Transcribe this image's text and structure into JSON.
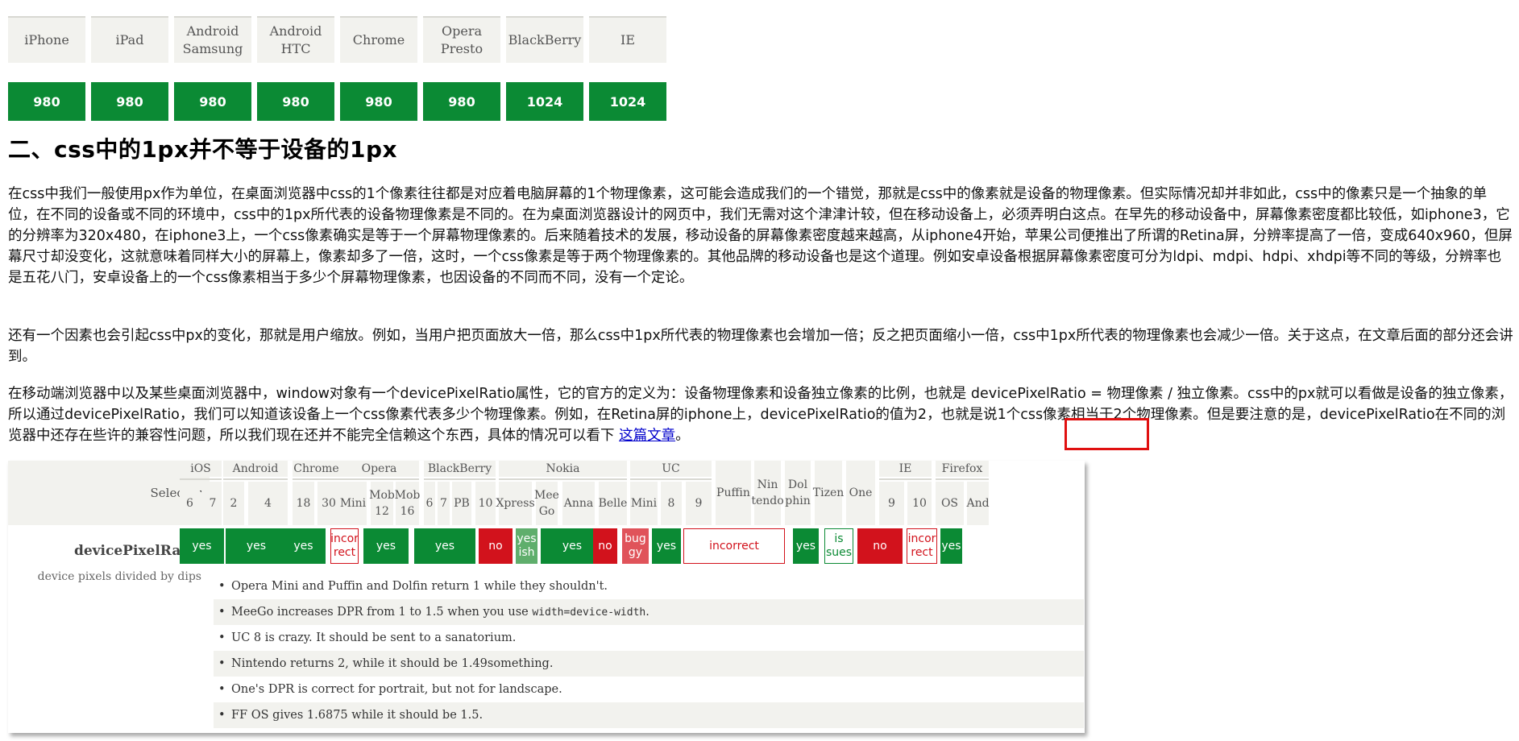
{
  "viewport_table": {
    "headers": [
      "iPhone",
      "iPad",
      "Android\nSamsung",
      "Android\nHTC",
      "Chrome",
      "Opera Presto",
      "BlackBerry",
      "IE"
    ],
    "values": [
      "980",
      "980",
      "980",
      "980",
      "980",
      "980",
      "1024",
      "1024"
    ],
    "header_bg": "#f2f2ee",
    "value_bg": "#0b8a34"
  },
  "heading": "二、css中的1px并不等于设备的1px",
  "paragraphs": {
    "p1": "在css中我们一般使用px作为单位，在桌面浏览器中css的1个像素往往都是对应着电脑屏幕的1个物理像素，这可能会造成我们的一个错觉，那就是css中的像素就是设备的物理像素。但实际情况却并非如此，css中的像素只是一个抽象的单位，在不同的设备或不同的环境中，css中的1px所代表的设备物理像素是不同的。在为桌面浏览器设计的网页中，我们无需对这个津津计较，但在移动设备上，必须弄明白这点。在早先的移动设备中，屏幕像素密度都比较低，如iphone3，它的分辨率为320x480，在iphone3上，一个css像素确实是等于一个屏幕物理像素的。后来随着技术的发展，移动设备的屏幕像素密度越来越高，从iphone4开始，苹果公司便推出了所谓的Retina屏，分辨率提高了一倍，变成640x960，但屏幕尺寸却没变化，这就意味着同样大小的屏幕上，像素却多了一倍，这时，一个css像素是等于两个物理像素的。其他品牌的移动设备也是这个道理。例如安卓设备根据屏幕像素密度可分为ldpi、mdpi、hdpi、xhdpi等不同的等级，分辨率也是五花八门，安卓设备上的一个css像素相当于多少个屏幕物理像素，也因设备的不同而不同，没有一个定论。",
    "p2": "还有一个因素也会引起css中px的变化，那就是用户缩放。例如，当用户把页面放大一倍，那么css中1px所代表的物理像素也会增加一倍；反之把页面缩小一倍，css中1px所代表的物理像素也会减少一倍。关于这点，在文章后面的部分还会讲到。",
    "p3_before": "在移动端浏览器中以及某些桌面浏览器中，window对象有一个devicePixelRatio属性，它的官方的定义为：设备物理像素和设备独立像素的比例，也就是 devicePixelRatio = 物理像素 / 独立像素。css中的px就可以看做是设备的独立像素，所以通过devicePixelRatio，我们可以知道该设备上一个css像素代表多少个物理像素。例如，在Retina屏的iphone上，devicePixelRatio的值为2，也就是说1个css像素相当于2个物理像素。但是要注意的是，devicePixelRatio在不同的浏览器中还存在些许的兼容性问题，所以我们现在还并不能完全信赖这个东西，具体的情况可以看下",
    "p3_link": "这篇文章",
    "p3_after": "。"
  },
  "highlight_color": "#e01010",
  "compat_table": {
    "selector_label": "Selector",
    "groups": [
      {
        "name": "iOS",
        "subs": [
          "6",
          "7"
        ]
      },
      {
        "name": "Android",
        "subs": [
          "2",
          "4"
        ]
      },
      {
        "name": "Chrome",
        "subs": [
          "18",
          "30"
        ]
      },
      {
        "name": "Opera",
        "subs": [
          "Mini",
          "Mob\n12",
          "Mob\n16"
        ]
      },
      {
        "name": "BlackBerry",
        "subs": [
          "6",
          "7",
          "PB",
          "10"
        ]
      },
      {
        "name": "Nokia",
        "subs": [
          "Xpress",
          "Mee\nGo",
          "Anna",
          "Belle"
        ]
      },
      {
        "name": "UC",
        "subs": [
          "Mini",
          "8",
          "9"
        ]
      },
      {
        "name": "",
        "subs": [
          "Puffin",
          "Nin\ntendo",
          "Dol\nphin",
          "Tizen",
          "One"
        ]
      },
      {
        "name": "IE",
        "subs": [
          "9",
          "10"
        ]
      },
      {
        "name": "Firefox",
        "subs": [
          "OS",
          "And"
        ]
      }
    ],
    "row_title": "devicePixelRatio",
    "row_subtitle": "device pixels divided by dips",
    "results": [
      "yes",
      "yes",
      "yes",
      "incor\nrect",
      "yes",
      "yes",
      "no",
      "yes\nish",
      "yes",
      "no",
      "bug\ngy",
      "yes",
      "incorrect",
      "yes",
      "is\nsues",
      "no",
      "incor\nrect",
      "yes"
    ],
    "notes": [
      {
        "text": "Opera Mini and Puffin and Dolfin return 1 while they shouldn't."
      },
      {
        "text_before": "MeeGo increases DPR from 1 to 1.5 when you use ",
        "code": "width=device-width",
        "text_after": "."
      },
      {
        "text": "UC 8 is crazy. It should be sent to a sanatorium."
      },
      {
        "text": "Nintendo returns 2, while it should be 1.49something."
      },
      {
        "text": "One's DPR is correct for portrait, but not for landscape."
      },
      {
        "text": "FF OS gives 1.6875 while it should be 1.5."
      }
    ],
    "colors": {
      "yes": "#0b8a34",
      "yesish": "#5fae6c",
      "no": "#d2121c",
      "buggy": "#e0535a"
    }
  }
}
